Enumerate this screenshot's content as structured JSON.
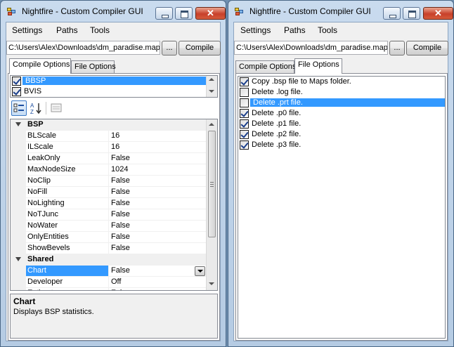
{
  "window_title": "Nightfire - Custom Compiler GUI",
  "menu": [
    "Settings",
    "Paths",
    "Tools"
  ],
  "map_path": "C:\\Users\\Alex\\Downloads\\dm_paradise.map",
  "browse_label": "...",
  "compile_label": "Compile",
  "tabs": [
    "Compile Options",
    "File Options"
  ],
  "compile_tools": [
    {
      "label": "BBSP",
      "checked": true,
      "selected": true
    },
    {
      "label": "BVIS",
      "checked": true,
      "selected": false
    }
  ],
  "property_grid": {
    "categories": [
      {
        "name": "BSP",
        "properties": [
          {
            "name": "BLScale",
            "value": "16"
          },
          {
            "name": "ILScale",
            "value": "16"
          },
          {
            "name": "LeakOnly",
            "value": "False"
          },
          {
            "name": "MaxNodeSize",
            "value": "1024"
          },
          {
            "name": "NoClip",
            "value": "False"
          },
          {
            "name": "NoFill",
            "value": "False"
          },
          {
            "name": "NoLighting",
            "value": "False"
          },
          {
            "name": "NoTJunc",
            "value": "False"
          },
          {
            "name": "NoWater",
            "value": "False"
          },
          {
            "name": "OnlyEntities",
            "value": "False"
          },
          {
            "name": "ShowBevels",
            "value": "False"
          }
        ]
      },
      {
        "name": "Shared",
        "properties": [
          {
            "name": "Chart",
            "value": "False",
            "selected": true
          },
          {
            "name": "Developer",
            "value": "Off"
          },
          {
            "name": "Estimate",
            "value": "False"
          }
        ]
      }
    ]
  },
  "help": {
    "title": "Chart",
    "description": "Displays BSP statistics."
  },
  "file_options": [
    {
      "label": "Copy .bsp file to Maps folder.",
      "checked": true,
      "selected": false
    },
    {
      "label": "Delete .log file.",
      "checked": false,
      "selected": false
    },
    {
      "label": "Delete .prt file.",
      "checked": false,
      "selected": true
    },
    {
      "label": "Delete .p0 file.",
      "checked": true,
      "selected": false
    },
    {
      "label": "Delete .p1 file.",
      "checked": true,
      "selected": false
    },
    {
      "label": "Delete .p2 file.",
      "checked": true,
      "selected": false
    },
    {
      "label": "Delete .p3 file.",
      "checked": true,
      "selected": false
    }
  ]
}
